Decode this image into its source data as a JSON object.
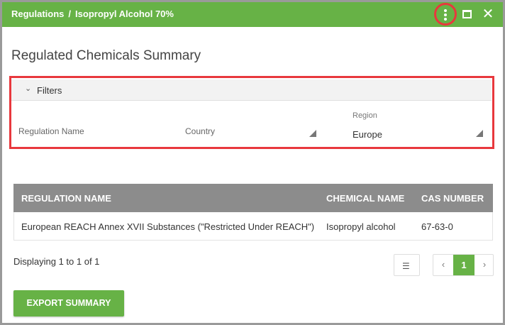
{
  "titlebar": {
    "breadcrumb": [
      "Regulations",
      "/",
      "Isopropyl Alcohol 70%"
    ],
    "icons": [
      "more-vertical-icon",
      "maximize-icon",
      "close-icon"
    ],
    "accent_color": "#67b246"
  },
  "page": {
    "title": "Regulated Chemicals Summary"
  },
  "filters": {
    "header": "Filters",
    "regulation_name_label": "Regulation Name",
    "country_label": "Country",
    "region_label": "Region",
    "region_value": "Europe"
  },
  "table": {
    "columns": [
      "REGULATION NAME",
      "CHEMICAL NAME",
      "CAS NUMBER"
    ],
    "rows": [
      [
        "European REACH Annex XVII Substances (\"Restricted Under REACH\")",
        "Isopropyl alcohol",
        "67-63-0"
      ]
    ]
  },
  "pagination": {
    "display_text": "Displaying 1 to 1 of 1",
    "prev": "‹",
    "current_page": "1",
    "next": "›"
  },
  "actions": {
    "export_label": "EXPORT SUMMARY"
  },
  "highlight_color": "#e8383d"
}
